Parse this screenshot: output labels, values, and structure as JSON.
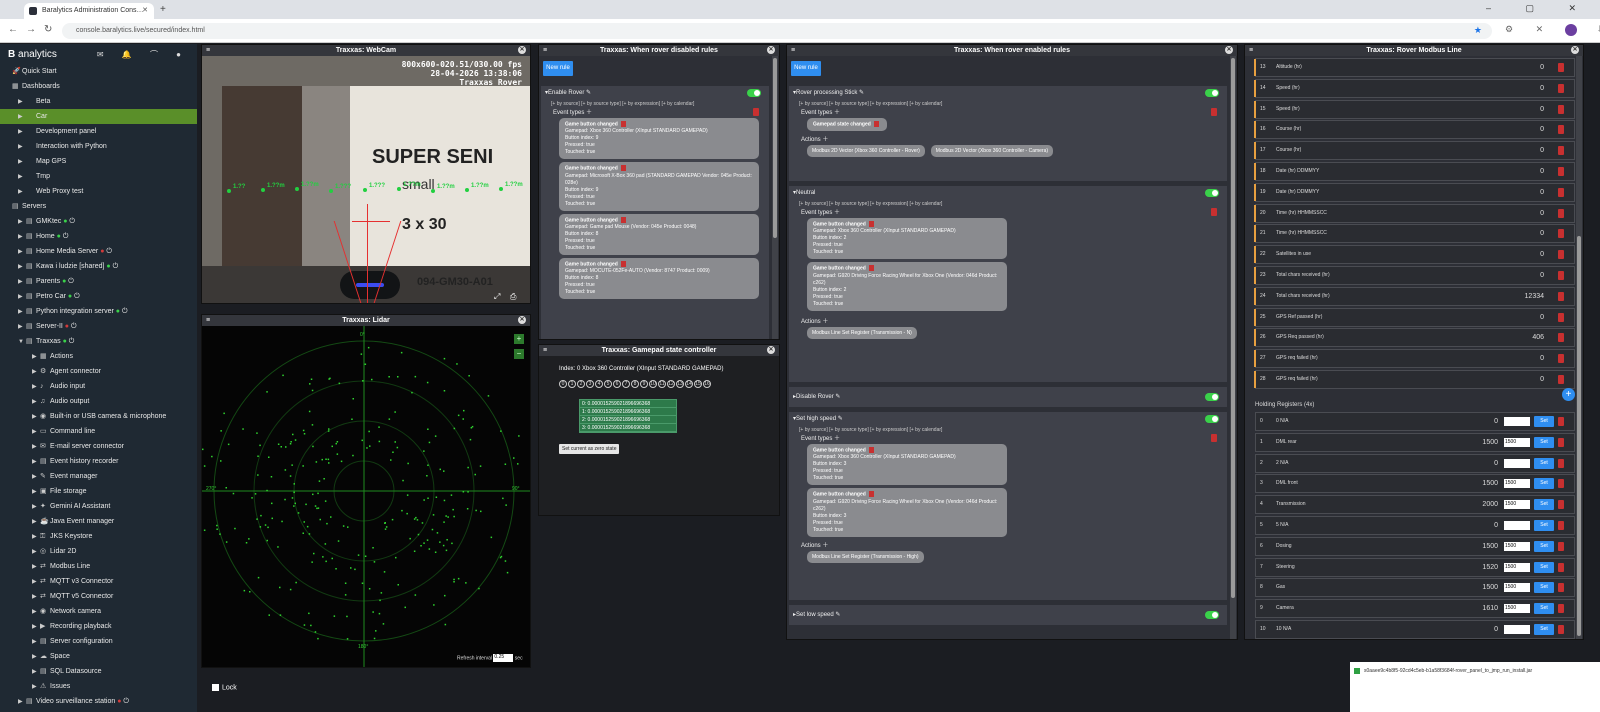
{
  "browser": {
    "tab_title": "Baralytics Administration Cons…",
    "tab_close": "✕",
    "new_tab": "+",
    "window_controls": "–  ▢  ✕",
    "url": "console.baralytics.live/secured/index.html",
    "star": "★",
    "toolbar_icons": "⚙ ✕ ⬚ ⇩",
    "back": "←",
    "forward": "→",
    "reload": "↻"
  },
  "brand": {
    "letter": "B",
    "name": "analytics",
    "icons": "✉ 🔔 ⌒ ●"
  },
  "sidebar": [
    {
      "label": "Quick Start",
      "level": 0,
      "icon": "🚀",
      "arrow": ""
    },
    {
      "label": "Dashboards",
      "level": 0,
      "icon": "▦",
      "arrow": ""
    },
    {
      "label": "Beta",
      "level": 1,
      "icon": "",
      "arrow": "▶"
    },
    {
      "label": "Car",
      "level": 1,
      "icon": "",
      "arrow": "▶",
      "selected": true
    },
    {
      "label": "Development panel",
      "level": 1,
      "icon": "",
      "arrow": "▶"
    },
    {
      "label": "Interaction with Python",
      "level": 1,
      "icon": "",
      "arrow": "▶"
    },
    {
      "label": "Map GPS",
      "level": 1,
      "icon": "",
      "arrow": "▶"
    },
    {
      "label": "Tmp",
      "level": 1,
      "icon": "",
      "arrow": "▶"
    },
    {
      "label": "Web Proxy test",
      "level": 1,
      "icon": "",
      "arrow": "▶"
    },
    {
      "label": "Servers",
      "level": 0,
      "icon": "▤",
      "arrow": ""
    },
    {
      "label": "GMKtec",
      "level": 1,
      "icon": "▤",
      "arrow": "▶",
      "status": "green"
    },
    {
      "label": "Home",
      "level": 1,
      "icon": "▤",
      "arrow": "▶",
      "status": "green"
    },
    {
      "label": "Home Media Server",
      "level": 1,
      "icon": "▤",
      "arrow": "▶",
      "status": "red"
    },
    {
      "label": "Kawa i ludzie [shared]",
      "level": 1,
      "icon": "▤",
      "arrow": "▶",
      "status": "green"
    },
    {
      "label": "Parents",
      "level": 1,
      "icon": "▤",
      "arrow": "▶",
      "status": "green"
    },
    {
      "label": "Petro Car",
      "level": 1,
      "icon": "▤",
      "arrow": "▶",
      "status": "green"
    },
    {
      "label": "Python integration server",
      "level": 1,
      "icon": "▤",
      "arrow": "▶",
      "status": "green"
    },
    {
      "label": "Server-II",
      "level": 1,
      "icon": "▤",
      "arrow": "▶",
      "status": "red"
    },
    {
      "label": "Traxxas",
      "level": 1,
      "icon": "▤",
      "arrow": "▼",
      "status": "green"
    },
    {
      "label": "Actions",
      "level": 2,
      "icon": "▦",
      "arrow": "▶"
    },
    {
      "label": "Agent connector",
      "level": 2,
      "icon": "⚙",
      "arrow": "▶"
    },
    {
      "label": "Audio input",
      "level": 2,
      "icon": "♪",
      "arrow": "▶"
    },
    {
      "label": "Audio output",
      "level": 2,
      "icon": "♫",
      "arrow": "▶"
    },
    {
      "label": "Built-in or USB camera & microphone",
      "level": 2,
      "icon": "◉",
      "arrow": "▶"
    },
    {
      "label": "Command line",
      "level": 2,
      "icon": "▭",
      "arrow": "▶"
    },
    {
      "label": "E-mail server connector",
      "level": 2,
      "icon": "✉",
      "arrow": "▶"
    },
    {
      "label": "Event history recorder",
      "level": 2,
      "icon": "▤",
      "arrow": "▶"
    },
    {
      "label": "Event manager",
      "level": 2,
      "icon": "✎",
      "arrow": "▶"
    },
    {
      "label": "File storage",
      "level": 2,
      "icon": "▣",
      "arrow": "▶"
    },
    {
      "label": "Gemini AI Assistant",
      "level": 2,
      "icon": "✦",
      "arrow": "▶"
    },
    {
      "label": "Java Event manager",
      "level": 2,
      "icon": "☕",
      "arrow": "▶"
    },
    {
      "label": "JKS Keystore",
      "level": 2,
      "icon": "⚿",
      "arrow": "▶"
    },
    {
      "label": "Lidar 2D",
      "level": 2,
      "icon": "◎",
      "arrow": "▶"
    },
    {
      "label": "Modbus Line",
      "level": 2,
      "icon": "⇄",
      "arrow": "▶"
    },
    {
      "label": "MQTT v3 Connector",
      "level": 2,
      "icon": "⇄",
      "arrow": "▶"
    },
    {
      "label": "MQTT v5 Connector",
      "level": 2,
      "icon": "⇄",
      "arrow": "▶"
    },
    {
      "label": "Network camera",
      "level": 2,
      "icon": "◉",
      "arrow": "▶"
    },
    {
      "label": "Recording playback",
      "level": 2,
      "icon": "▶",
      "arrow": "▶"
    },
    {
      "label": "Server configuration",
      "level": 2,
      "icon": "▤",
      "arrow": "▶"
    },
    {
      "label": "Space",
      "level": 2,
      "icon": "☁",
      "arrow": "▶"
    },
    {
      "label": "SQL Datasource",
      "level": 2,
      "icon": "▤",
      "arrow": "▶"
    },
    {
      "label": "Issues",
      "level": 2,
      "icon": "⚠",
      "arrow": "▶"
    },
    {
      "label": "Video surveillance station",
      "level": 1,
      "icon": "▤",
      "arrow": "▶",
      "status": "red"
    }
  ],
  "webcam": {
    "title": "Traxxas: WebCam",
    "overlay_line1": "800x600-020.51/030.00 fps",
    "overlay_line2": "28-04-2026 13:38:06",
    "overlay_line3": "Traxxas Rover",
    "box_text1": "SUPER SENI",
    "box_text2": "small",
    "box_text3": "3 x 30",
    "box_text4": "094-GM30-A01",
    "distance_labels": [
      "1.??",
      "1.??m",
      "1.??m",
      "1.???",
      "1.???",
      "1.??m",
      "1.??m",
      "1.??m",
      "1.??m"
    ]
  },
  "lidar": {
    "title": "Traxxas: Lidar",
    "angle_top": "0°",
    "angle_bottom": "180°",
    "angle_left": "270°",
    "angle_right": "90°",
    "zoom_in": "+",
    "zoom_out": "−",
    "refresh_label": "Refresh interval",
    "refresh_value": "0.25",
    "refresh_unit": "sec"
  },
  "lock": {
    "label": "Lock"
  },
  "disabled_rules": {
    "title": "Traxxas: When rover disabled rules",
    "new_rule": "New rule",
    "rule_name": "Enable Rover",
    "filters": "[+ by source] [+ by source type] [+ by expression] [+ by calendar]",
    "event_types_label": "Event types",
    "events": [
      {
        "title": "Game button changed",
        "lines": [
          "Gamepad: Xbox 360 Controller (XInput STANDARD GAMEPAD)",
          "Button index: 9",
          "Pressed: true",
          "Touched: true"
        ]
      },
      {
        "title": "Game button changed",
        "lines": [
          "Gamepad: Microsoft X-Box 360 pad (STANDARD GAMEPAD Vendor: 045e Product: 028e)",
          "Button index: 9",
          "Pressed: true",
          "Touched: true"
        ]
      },
      {
        "title": "Game button changed",
        "lines": [
          "Gamepad: Game pad Mouse (Vendor: 045e Product: 0048)",
          "Button index: 8",
          "Pressed: true",
          "Touched: true"
        ]
      },
      {
        "title": "Game button changed",
        "lines": [
          "Gamepad: MOCUTE-052Fe-AUTO (Vendor: 8747 Product: 0009)",
          "Button index: 8",
          "Pressed: true",
          "Touched: true"
        ]
      }
    ]
  },
  "gamepad": {
    "title": "Traxxas: Gamepad state controller",
    "index_line": "Index: 0   Xbox 360 Controller (XInput STANDARD GAMEPAD)",
    "buttons": [
      "0",
      "1",
      "2",
      "3",
      "4",
      "5",
      "6",
      "7",
      "8",
      "9",
      "10",
      "11",
      "12",
      "13",
      "14",
      "15",
      "16"
    ],
    "axes": [
      "0: 0.000015259021896696368",
      "1: 0.000015259021896696368",
      "2: 0.000015259021896696368",
      "3: 0.000015259021896696368"
    ],
    "zero_button": "Set current as zero state"
  },
  "enabled_rules": {
    "title": "Traxxas: When rover enabled rules",
    "new_rule": "New rule",
    "filters": "[+ by source] [+ by source type] [+ by expression] [+ by calendar]",
    "event_types_label": "Event types",
    "actions_label": "Actions",
    "rule1": {
      "name": "Rover processing Stick",
      "event": "Gamepad state changed",
      "actions": [
        "Modbus 2D Vector (Xbox 360 Controller - Rover)",
        "Modbus 2D Vector (Xbox 360 Controller - Camera)"
      ]
    },
    "rule2": {
      "name": "Neutral",
      "events": [
        {
          "title": "Game button changed",
          "lines": [
            "Gamepad: Xbox 360 Controller (XInput STANDARD GAMEPAD)",
            "Button index: 2",
            "Pressed: true",
            "Touched: true"
          ]
        },
        {
          "title": "Game button changed",
          "lines": [
            "Gamepad: G920 Driving Force Racing Wheel for Xbox One (Vendor: 046d Product: c262)",
            "Button index: 2",
            "Pressed: true",
            "Touched: true"
          ]
        }
      ],
      "action": "Modbus Line Set Register (Transmission - N)"
    },
    "rule3": {
      "name": "Disable Rover"
    },
    "rule4": {
      "name": "Set high speed",
      "events": [
        {
          "title": "Game button changed",
          "lines": [
            "Gamepad: Xbox 360 Controller (XInput STANDARD GAMEPAD)",
            "Button index: 3",
            "Pressed: true",
            "Touched: true"
          ]
        },
        {
          "title": "Game button changed",
          "lines": [
            "Gamepad: G920 Driving Force Racing Wheel for Xbox One (Vendor: 046d Product: c262)",
            "Button index: 3",
            "Pressed: true",
            "Touched: true"
          ]
        }
      ],
      "action": "Modbus Line Set Register (Transmission - High)"
    },
    "rule5": {
      "name": "Set low speed"
    }
  },
  "modbus": {
    "title": "Traxxas: Rover Modbus Line",
    "input_rows": [
      {
        "n": "13",
        "name": "Altitude (hr)",
        "value": "0"
      },
      {
        "n": "14",
        "name": "Speed (hr)",
        "value": "0"
      },
      {
        "n": "15",
        "name": "Speed (hr)",
        "value": "0"
      },
      {
        "n": "16",
        "name": "Course (hr)",
        "value": "0"
      },
      {
        "n": "17",
        "name": "Course (hr)",
        "value": "0"
      },
      {
        "n": "18",
        "name": "Date (hr) DDMMYY",
        "value": "0"
      },
      {
        "n": "19",
        "name": "Date (hr) DDMMYY",
        "value": "0"
      },
      {
        "n": "20",
        "name": "Time (hr) HHMMSSCC",
        "value": "0"
      },
      {
        "n": "21",
        "name": "Time (hr) HHMMSSCC",
        "value": "0"
      },
      {
        "n": "22",
        "name": "Satellites in use",
        "value": "0"
      },
      {
        "n": "23",
        "name": "Total chars received (hr)",
        "value": "0"
      },
      {
        "n": "24",
        "name": "Total chars received (hr)",
        "value": "12334"
      },
      {
        "n": "25",
        "name": "GPS Ref passed (hr)",
        "value": "0"
      },
      {
        "n": "26",
        "name": "GPS Req passed (hr)",
        "value": "406"
      },
      {
        "n": "27",
        "name": "GPS req failed (hr)",
        "value": "0"
      },
      {
        "n": "28",
        "name": "GPS req failed (hr)",
        "value": "0"
      }
    ],
    "holding_title": "Holding Registers (4x)",
    "set_label": "Set",
    "holding_rows": [
      {
        "n": "0",
        "name": "0 N/A",
        "value": "0",
        "input": ""
      },
      {
        "n": "1",
        "name": "DML rear",
        "value": "1500",
        "input": "1500"
      },
      {
        "n": "2",
        "name": "2 N/A",
        "value": "0",
        "input": ""
      },
      {
        "n": "3",
        "name": "DML front",
        "value": "1500",
        "input": "1500"
      },
      {
        "n": "4",
        "name": "Transmission",
        "value": "2000",
        "input": "1500"
      },
      {
        "n": "5",
        "name": "5 N/A",
        "value": "0",
        "input": ""
      },
      {
        "n": "6",
        "name": "Dosing",
        "value": "1500",
        "input": "1500"
      },
      {
        "n": "7",
        "name": "Steering",
        "value": "1520",
        "input": "1500"
      },
      {
        "n": "8",
        "name": "Gas",
        "value": "1500",
        "input": "1500"
      },
      {
        "n": "9",
        "name": "Camera",
        "value": "1610",
        "input": "1500"
      },
      {
        "n": "10",
        "name": "10 N/A",
        "value": "0",
        "input": ""
      }
    ],
    "fab": "+"
  },
  "download": {
    "text": "s0aaee9c4b8f5-92cd4c5eb-b1a58f3684f-rover_panel_to_jmp_run_install.jar"
  }
}
